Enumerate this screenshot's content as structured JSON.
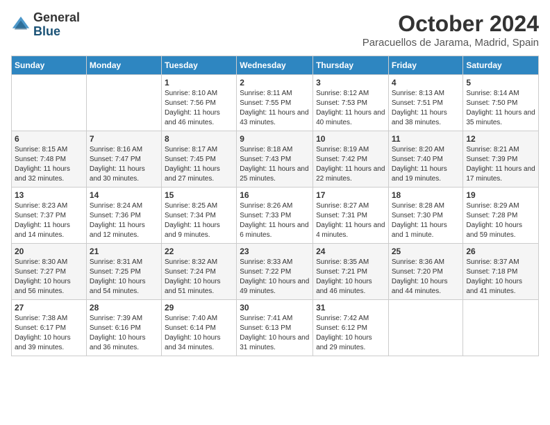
{
  "header": {
    "logo_general": "General",
    "logo_blue": "Blue",
    "month": "October 2024",
    "location": "Paracuellos de Jarama, Madrid, Spain"
  },
  "weekdays": [
    "Sunday",
    "Monday",
    "Tuesday",
    "Wednesday",
    "Thursday",
    "Friday",
    "Saturday"
  ],
  "weeks": [
    [
      {
        "day": "",
        "info": ""
      },
      {
        "day": "",
        "info": ""
      },
      {
        "day": "1",
        "info": "Sunrise: 8:10 AM\nSunset: 7:56 PM\nDaylight: 11 hours and 46 minutes."
      },
      {
        "day": "2",
        "info": "Sunrise: 8:11 AM\nSunset: 7:55 PM\nDaylight: 11 hours and 43 minutes."
      },
      {
        "day": "3",
        "info": "Sunrise: 8:12 AM\nSunset: 7:53 PM\nDaylight: 11 hours and 40 minutes."
      },
      {
        "day": "4",
        "info": "Sunrise: 8:13 AM\nSunset: 7:51 PM\nDaylight: 11 hours and 38 minutes."
      },
      {
        "day": "5",
        "info": "Sunrise: 8:14 AM\nSunset: 7:50 PM\nDaylight: 11 hours and 35 minutes."
      }
    ],
    [
      {
        "day": "6",
        "info": "Sunrise: 8:15 AM\nSunset: 7:48 PM\nDaylight: 11 hours and 32 minutes."
      },
      {
        "day": "7",
        "info": "Sunrise: 8:16 AM\nSunset: 7:47 PM\nDaylight: 11 hours and 30 minutes."
      },
      {
        "day": "8",
        "info": "Sunrise: 8:17 AM\nSunset: 7:45 PM\nDaylight: 11 hours and 27 minutes."
      },
      {
        "day": "9",
        "info": "Sunrise: 8:18 AM\nSunset: 7:43 PM\nDaylight: 11 hours and 25 minutes."
      },
      {
        "day": "10",
        "info": "Sunrise: 8:19 AM\nSunset: 7:42 PM\nDaylight: 11 hours and 22 minutes."
      },
      {
        "day": "11",
        "info": "Sunrise: 8:20 AM\nSunset: 7:40 PM\nDaylight: 11 hours and 19 minutes."
      },
      {
        "day": "12",
        "info": "Sunrise: 8:21 AM\nSunset: 7:39 PM\nDaylight: 11 hours and 17 minutes."
      }
    ],
    [
      {
        "day": "13",
        "info": "Sunrise: 8:23 AM\nSunset: 7:37 PM\nDaylight: 11 hours and 14 minutes."
      },
      {
        "day": "14",
        "info": "Sunrise: 8:24 AM\nSunset: 7:36 PM\nDaylight: 11 hours and 12 minutes."
      },
      {
        "day": "15",
        "info": "Sunrise: 8:25 AM\nSunset: 7:34 PM\nDaylight: 11 hours and 9 minutes."
      },
      {
        "day": "16",
        "info": "Sunrise: 8:26 AM\nSunset: 7:33 PM\nDaylight: 11 hours and 6 minutes."
      },
      {
        "day": "17",
        "info": "Sunrise: 8:27 AM\nSunset: 7:31 PM\nDaylight: 11 hours and 4 minutes."
      },
      {
        "day": "18",
        "info": "Sunrise: 8:28 AM\nSunset: 7:30 PM\nDaylight: 11 hours and 1 minute."
      },
      {
        "day": "19",
        "info": "Sunrise: 8:29 AM\nSunset: 7:28 PM\nDaylight: 10 hours and 59 minutes."
      }
    ],
    [
      {
        "day": "20",
        "info": "Sunrise: 8:30 AM\nSunset: 7:27 PM\nDaylight: 10 hours and 56 minutes."
      },
      {
        "day": "21",
        "info": "Sunrise: 8:31 AM\nSunset: 7:25 PM\nDaylight: 10 hours and 54 minutes."
      },
      {
        "day": "22",
        "info": "Sunrise: 8:32 AM\nSunset: 7:24 PM\nDaylight: 10 hours and 51 minutes."
      },
      {
        "day": "23",
        "info": "Sunrise: 8:33 AM\nSunset: 7:22 PM\nDaylight: 10 hours and 49 minutes."
      },
      {
        "day": "24",
        "info": "Sunrise: 8:35 AM\nSunset: 7:21 PM\nDaylight: 10 hours and 46 minutes."
      },
      {
        "day": "25",
        "info": "Sunrise: 8:36 AM\nSunset: 7:20 PM\nDaylight: 10 hours and 44 minutes."
      },
      {
        "day": "26",
        "info": "Sunrise: 8:37 AM\nSunset: 7:18 PM\nDaylight: 10 hours and 41 minutes."
      }
    ],
    [
      {
        "day": "27",
        "info": "Sunrise: 7:38 AM\nSunset: 6:17 PM\nDaylight: 10 hours and 39 minutes."
      },
      {
        "day": "28",
        "info": "Sunrise: 7:39 AM\nSunset: 6:16 PM\nDaylight: 10 hours and 36 minutes."
      },
      {
        "day": "29",
        "info": "Sunrise: 7:40 AM\nSunset: 6:14 PM\nDaylight: 10 hours and 34 minutes."
      },
      {
        "day": "30",
        "info": "Sunrise: 7:41 AM\nSunset: 6:13 PM\nDaylight: 10 hours and 31 minutes."
      },
      {
        "day": "31",
        "info": "Sunrise: 7:42 AM\nSunset: 6:12 PM\nDaylight: 10 hours and 29 minutes."
      },
      {
        "day": "",
        "info": ""
      },
      {
        "day": "",
        "info": ""
      }
    ]
  ]
}
